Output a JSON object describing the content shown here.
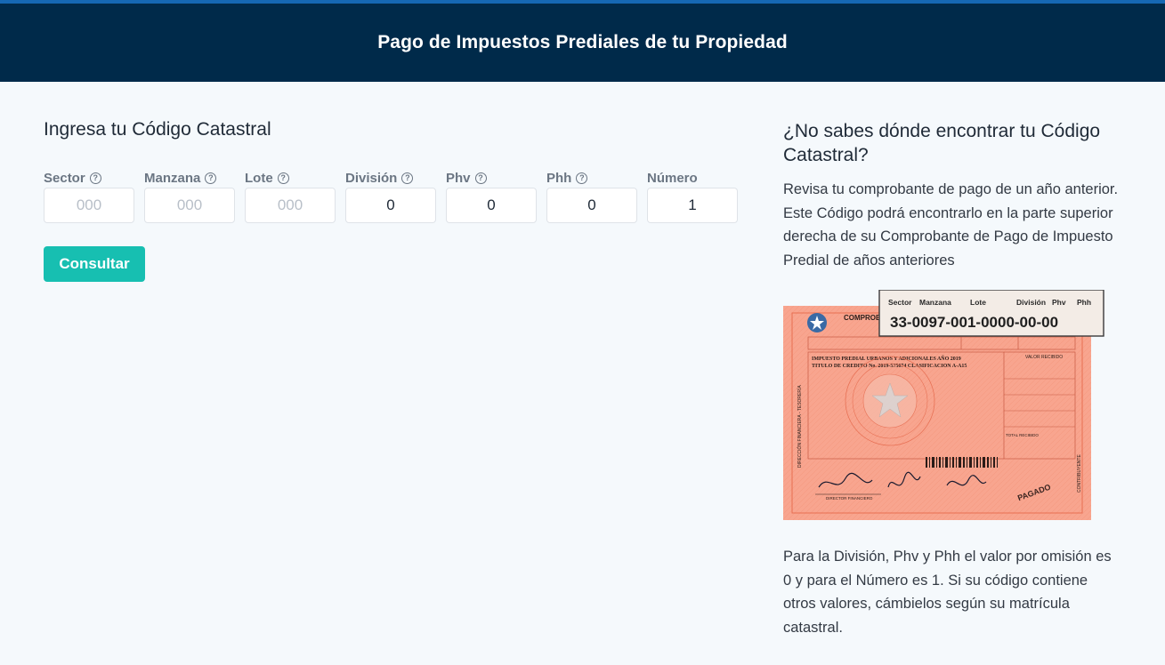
{
  "header": {
    "title": "Pago de Impuestos Prediales de tu Propiedad"
  },
  "form": {
    "title": "Ingresa tu Código Catastral",
    "fields": [
      {
        "label": "Sector",
        "help": true,
        "value": "",
        "placeholder": "000"
      },
      {
        "label": "Manzana",
        "help": true,
        "value": "",
        "placeholder": "000"
      },
      {
        "label": "Lote",
        "help": true,
        "value": "",
        "placeholder": "000"
      },
      {
        "label": "División",
        "help": true,
        "value": "0",
        "placeholder": ""
      },
      {
        "label": "Phv",
        "help": true,
        "value": "0",
        "placeholder": ""
      },
      {
        "label": "Phh",
        "help": true,
        "value": "0",
        "placeholder": ""
      },
      {
        "label": "Número",
        "help": false,
        "value": "1",
        "placeholder": ""
      }
    ],
    "submit_label": "Consultar"
  },
  "help": {
    "title": "¿No sabes dónde encontrar tu Código Catastral?",
    "paragraph1": "Revisa tu comprobante de pago de un año anterior. Este Código podrá encontrarlo en la parte superior derecha de su Comprobante de Pago de Impuesto Predial de años anteriores",
    "callout": {
      "labels": [
        "Sector",
        "Manzana",
        "Lote",
        "División",
        "Phv",
        "Phh"
      ],
      "code": "33-0097-001-0000-00-00"
    },
    "receipt": {
      "header": "COMPROBANTE DE INGRESO A CAJA",
      "concept": "IMPUESTO PREDIAL URBANOS Y ADICIONALES AÑO 2019",
      "credit": "TITULO DE CREDITO No. 2019-575674 CLASIFICACION A-A15",
      "value_label": "VALOR RECIBIDO",
      "total_label": "TOTAL RECIBIDO",
      "stamp": "PAGADO",
      "side_left": "DIRECCIÓN FINANCIERA - TESORERÍA",
      "side_right": "CONTRIBUYENTE",
      "signature_label": "DIRECTOR FINANCIERO"
    },
    "paragraph2": "Para la División, Phv y Phh el valor por omisión es 0 y para el Número es 1. Si su código contiene otros valores, cámbielos según su matrícula catastral."
  },
  "colors": {
    "header_bg": "#002a4a",
    "accent_bar": "#1668b3",
    "button": "#17bfb1",
    "page_bg": "#f5f9fc",
    "receipt": "#f8a58f"
  }
}
